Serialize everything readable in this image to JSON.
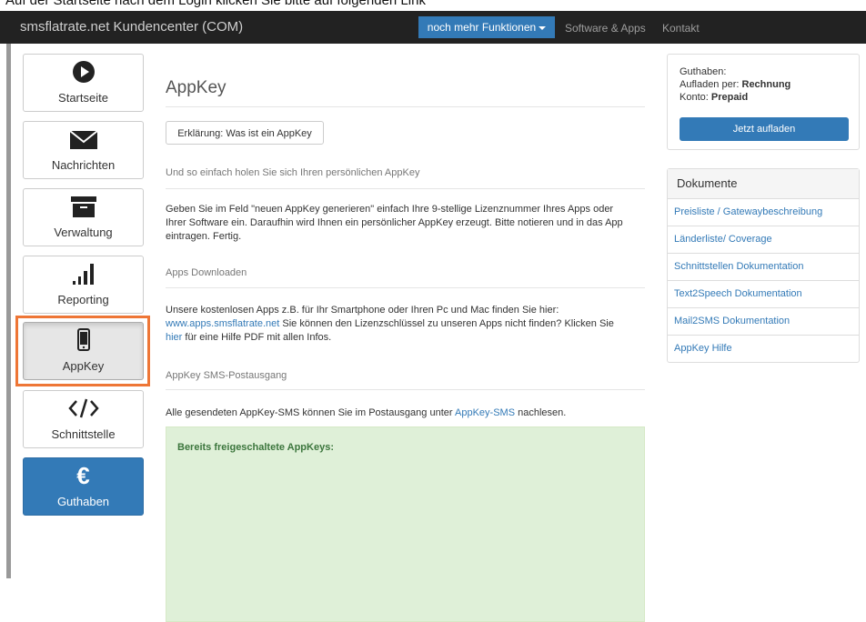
{
  "caption": "Auf der Startseite nach dem Login klicken Sie bitte auf folgenden Link",
  "navbar": {
    "brand": "smsflatrate.net Kundencenter (COM)",
    "dropdown_label": "noch mehr Funktionen",
    "links": [
      "Software & Apps",
      "Kontakt"
    ]
  },
  "sidebar": {
    "items": [
      {
        "label": "Startseite",
        "icon": "play-circle-icon"
      },
      {
        "label": "Nachrichten",
        "icon": "envelope-icon"
      },
      {
        "label": "Verwaltung",
        "icon": "archive-icon"
      },
      {
        "label": "Reporting",
        "icon": "signal-bars-icon"
      },
      {
        "label": "AppKey",
        "icon": "mobile-phone-icon"
      },
      {
        "label": "Schnittstelle",
        "icon": "code-icon"
      },
      {
        "label": "Guthaben",
        "icon": "euro-icon"
      }
    ],
    "active": "AppKey",
    "highlight_color": "#ee7636"
  },
  "main": {
    "title": "AppKey",
    "explain_button": "Erklärung: Was ist ein AppKey",
    "section1_title": "Und so einfach holen Sie sich Ihren persönlichen AppKey",
    "section1_text_lines": [
      "Geben Sie im Feld \"neuen AppKey generieren\" einfach Ihre 9-stellige Lizenznummer Ihres Apps oder",
      "Ihrer Software ein. Daraufhin wird Ihnen ein persönlicher AppKey erzeugt. Bitte notieren und in das App",
      "eintragen. Fertig."
    ],
    "section2_title": "Apps Downloaden",
    "section2_line1": "Unsere kostenlosen Apps z.B. für Ihr Smartphone oder Ihren Pc und Mac finden Sie hier:",
    "section2_link": "www.apps.smsflatrate.net",
    "section2_line2_rest": " Sie können den Lizenzschlüssel zu unseren Apps nicht finden? Klicken Sie",
    "section2_link2": "hier",
    "section2_line3_rest": " für eine Hilfe PDF mit allen Infos.",
    "section3_title": "AppKey SMS-Postausgang",
    "section3_text_pre": "Alle gesendeten AppKey-SMS können Sie im Postausgang unter ",
    "section3_link": "AppKey-SMS",
    "section3_text_post": " nachlesen.",
    "unlocked_title": "Bereits freigeschaltete AppKeys:"
  },
  "balance": {
    "label": "Guthaben:",
    "charge_via_label": "Aufladen per: ",
    "charge_via_value": "Rechnung",
    "account_label": "Konto: ",
    "account_value": "Prepaid",
    "charge_button": "Jetzt aufladen"
  },
  "documents": {
    "title": "Dokumente",
    "items": [
      "Preisliste / Gatewaybeschreibung",
      "Länderliste/ Coverage",
      "Schnittstellen Dokumentation",
      "Text2Speech Dokumentation",
      "Mail2SMS Dokumentation",
      "AppKey Hilfe"
    ]
  }
}
